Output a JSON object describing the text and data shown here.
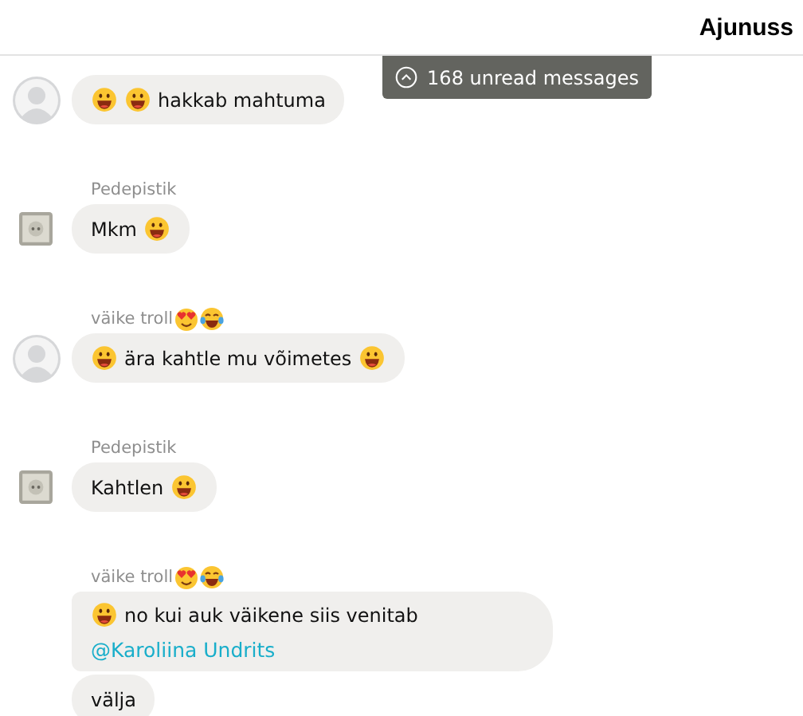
{
  "header": {
    "title": "Ajunuss"
  },
  "unread": {
    "label": "168 unread messages"
  },
  "groups": [
    {
      "avatar": {
        "kind": "person"
      },
      "messages": [
        {
          "parts": [
            {
              "kind": "grin"
            },
            {
              "kind": "grin"
            },
            {
              "kind": "text",
              "text": "hakkab mahtuma"
            }
          ]
        }
      ]
    },
    {
      "author": "Pedepistik",
      "avatar": {
        "kind": "socket"
      },
      "messages": [
        {
          "parts": [
            {
              "kind": "text",
              "text": "Mkm"
            },
            {
              "kind": "grin"
            }
          ]
        }
      ]
    },
    {
      "author": "väike troll",
      "author_emojis": [
        {
          "kind": "heart-eyes"
        },
        {
          "kind": "joy"
        }
      ],
      "avatar": {
        "kind": "person"
      },
      "messages": [
        {
          "parts": [
            {
              "kind": "grin"
            },
            {
              "kind": "text",
              "text": "ära kahtle mu võimetes"
            },
            {
              "kind": "grin"
            }
          ]
        }
      ]
    },
    {
      "author": "Pedepistik",
      "avatar": {
        "kind": "socket"
      },
      "messages": [
        {
          "parts": [
            {
              "kind": "text",
              "text": "Kahtlen"
            },
            {
              "kind": "grin"
            }
          ]
        }
      ]
    },
    {
      "author": "väike troll",
      "author_emojis": [
        {
          "kind": "heart-eyes"
        },
        {
          "kind": "joy"
        }
      ],
      "messages": [
        {
          "parts": [
            {
              "kind": "grin"
            },
            {
              "kind": "text",
              "text": "no kui auk väikene siis venitab"
            }
          ],
          "mention": "@Karoliina Undrits"
        },
        {
          "parts": [
            {
              "kind": "text",
              "text": "välja"
            }
          ]
        }
      ]
    }
  ]
}
